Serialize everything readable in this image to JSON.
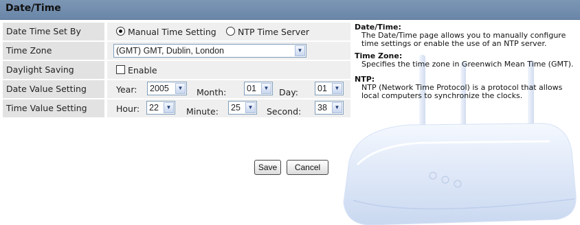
{
  "title": "Date/Time",
  "rows": [
    {
      "label": "Date Time Set By"
    },
    {
      "label": "Time Zone"
    },
    {
      "label": "Daylight Saving"
    },
    {
      "label": "Date Value Setting"
    },
    {
      "label": "Time Value Setting"
    }
  ],
  "date_time_set_by": {
    "manual_label": "Manual Time Setting",
    "ntp_label": "NTP Time Server",
    "selected": "manual"
  },
  "time_zone": {
    "selected": "(GMT) GMT, Dublin, London"
  },
  "daylight_saving": {
    "label": "Enable",
    "checked": false
  },
  "date_value": {
    "year_label": "Year:",
    "year": "2005",
    "month_label": "Month:",
    "month": "01",
    "day_label": "Day:",
    "day": "01"
  },
  "time_value": {
    "hour_label": "Hour:",
    "hour": "22",
    "minute_label": "Minute:",
    "minute": "25",
    "second_label": "Second:",
    "second": "38"
  },
  "buttons": {
    "save": "Save",
    "cancel": "Cancel"
  },
  "help": [
    {
      "heading": "Date/Time:",
      "text": "The Date/Time page allows you to manually configure time settings or enable the use of an NTP server."
    },
    {
      "heading": "Time Zone:",
      "text": "Specifies the time zone in Greenwich Mean Time (GMT)."
    },
    {
      "heading": "NTP:",
      "text": "NTP (Network Time Protocol) is a protocol that allows local computers to synchronize the clocks."
    }
  ],
  "colors": {
    "header_bg": "#6f8aab",
    "label_bg": "#e2e2e2",
    "value_bg": "#efefef"
  }
}
